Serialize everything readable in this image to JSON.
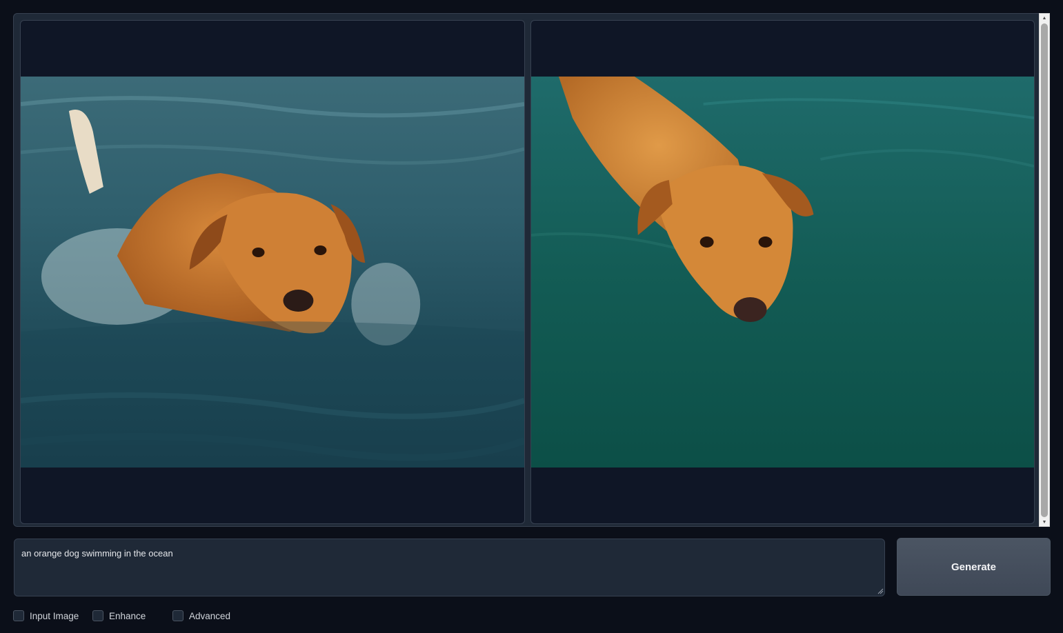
{
  "gallery": {
    "images": [
      {
        "name": "orange-dog-swimming-waves"
      },
      {
        "name": "orange-dog-swimming-green-water"
      }
    ]
  },
  "prompt": {
    "value": "an orange dog swimming in the ocean"
  },
  "generate_button": {
    "label": "Generate"
  },
  "options": {
    "input_image": {
      "label": "Input Image",
      "checked": false
    },
    "enhance": {
      "label": "Enhance",
      "checked": false
    },
    "advanced": {
      "label": "Advanced",
      "checked": false
    }
  },
  "colors": {
    "background": "#0b0f19",
    "panel": "#1f2937",
    "button": "#4b5563"
  }
}
